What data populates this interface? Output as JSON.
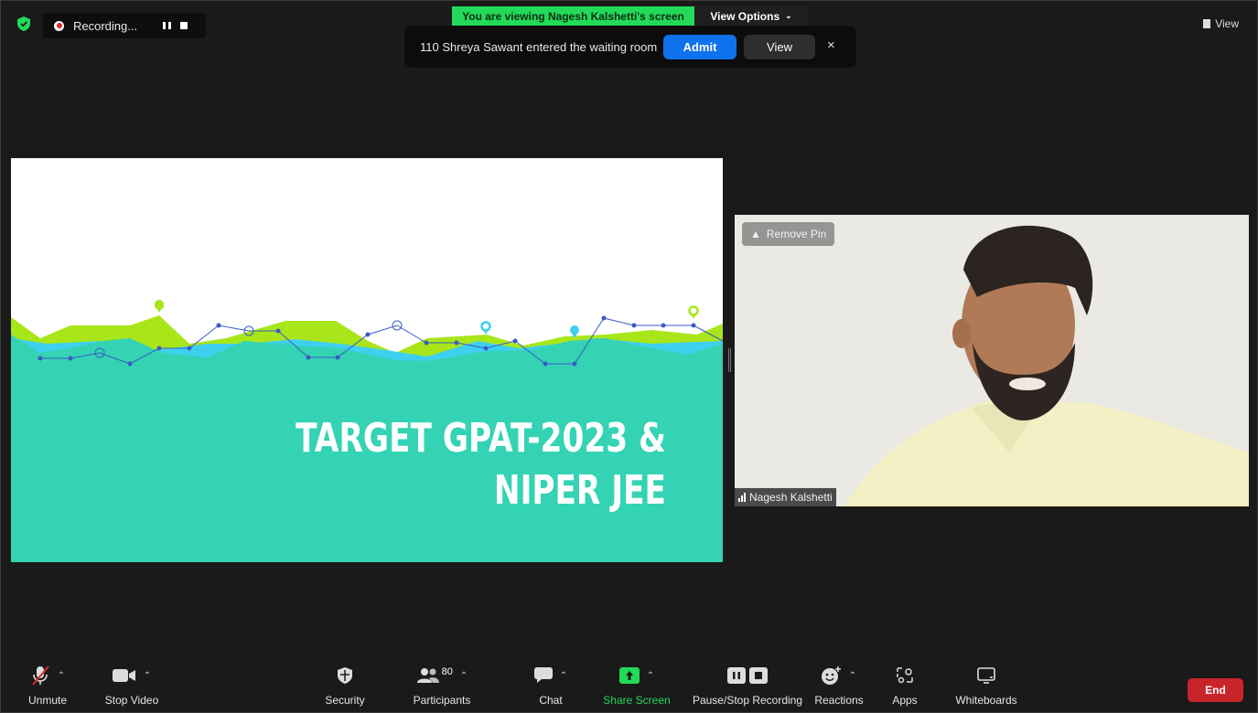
{
  "recording": {
    "label": "Recording..."
  },
  "banner": {
    "viewing": "You are viewing Nagesh Kalshetti's screen",
    "view_options": "View Options"
  },
  "top_right": {
    "view_label": "View"
  },
  "notification": {
    "message": "110 Shreya Sawant entered the waiting room",
    "admit": "Admit",
    "view": "View",
    "close": "×"
  },
  "slide": {
    "title_line1": "TARGET GPAT-2023 &",
    "title_line2": "NIPER JEE"
  },
  "video": {
    "remove_pin": "Remove Pin",
    "participant_name": "Nagesh Kalshetti"
  },
  "toolbar": {
    "unmute": "Unmute",
    "stop_video": "Stop Video",
    "security": "Security",
    "participants": "Participants",
    "participants_count": "80",
    "chat": "Chat",
    "share_screen": "Share Screen",
    "pause_stop_recording": "Pause/Stop Recording",
    "reactions": "Reactions",
    "apps": "Apps",
    "whiteboards": "Whiteboards",
    "end": "End"
  },
  "colors": {
    "accent_green": "#23d959",
    "admit_blue": "#0e72ed",
    "end_red": "#c8252b",
    "slide_teal": "#33d3b4",
    "slide_lime": "#a8e619",
    "slide_cyan": "#3fd0ef"
  }
}
